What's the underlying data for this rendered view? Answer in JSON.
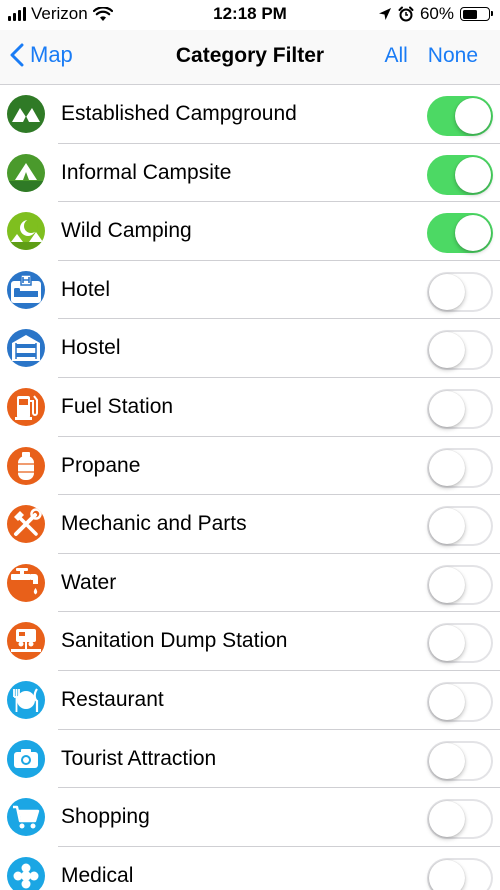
{
  "status_bar": {
    "carrier": "Verizon",
    "time": "12:18 PM",
    "battery": "60%",
    "battery_level": 0.6
  },
  "nav": {
    "back_label": "Map",
    "title": "Category Filter",
    "all_label": "All",
    "none_label": "None"
  },
  "colors": {
    "accent": "#1a7cf5",
    "toggle_on": "#4cd964",
    "camp_dark": "#2f7a26",
    "camp_mid": "#4a9a2c",
    "camp_light": "#7fbf1f",
    "lodging_blue": "#2a75c8",
    "service_orange": "#e8601a",
    "poi_cyan": "#1ba6e4"
  },
  "categories": [
    {
      "label": "Established Campground",
      "icon": "tent-mountains-icon",
      "enabled": true
    },
    {
      "label": "Informal Campsite",
      "icon": "tent-icon",
      "enabled": true
    },
    {
      "label": "Wild Camping",
      "icon": "moon-tent-icon",
      "enabled": true
    },
    {
      "label": "Hotel",
      "icon": "hotel-bed-icon",
      "enabled": false
    },
    {
      "label": "Hostel",
      "icon": "bunk-bed-icon",
      "enabled": false
    },
    {
      "label": "Fuel Station",
      "icon": "fuel-pump-icon",
      "enabled": false
    },
    {
      "label": "Propane",
      "icon": "propane-tank-icon",
      "enabled": false
    },
    {
      "label": "Mechanic and Parts",
      "icon": "wrench-hammer-icon",
      "enabled": false
    },
    {
      "label": "Water",
      "icon": "water-faucet-icon",
      "enabled": false
    },
    {
      "label": "Sanitation Dump Station",
      "icon": "dump-station-icon",
      "enabled": false
    },
    {
      "label": "Restaurant",
      "icon": "fork-knife-icon",
      "enabled": false
    },
    {
      "label": "Tourist Attraction",
      "icon": "camera-icon",
      "enabled": false
    },
    {
      "label": "Shopping",
      "icon": "shopping-cart-icon",
      "enabled": false
    },
    {
      "label": "Medical",
      "icon": "medical-icon",
      "enabled": false
    }
  ]
}
